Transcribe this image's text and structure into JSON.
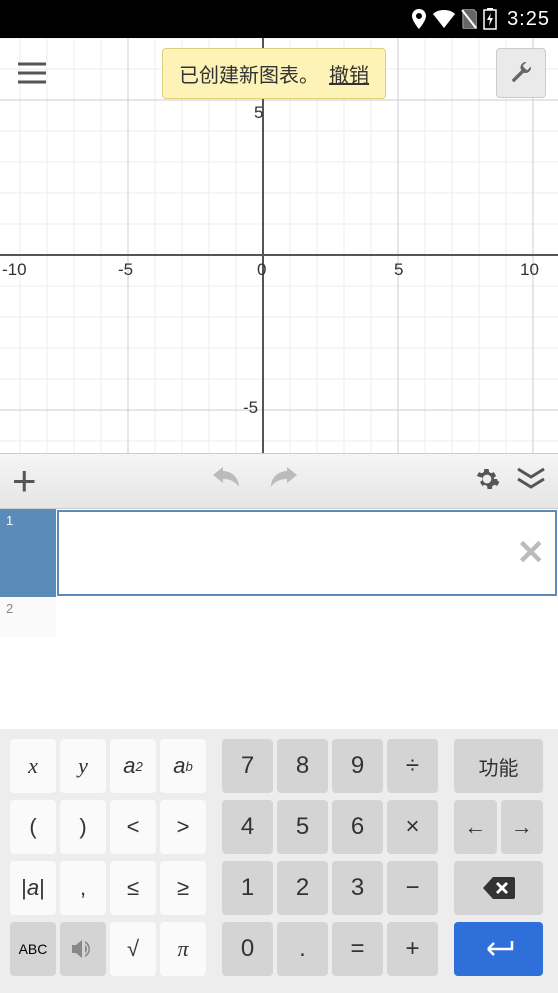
{
  "status": {
    "time": "3:25"
  },
  "toast": {
    "message": "已创建新图表。",
    "undo": "撤销"
  },
  "chart_data": {
    "type": "line",
    "series": [],
    "title": "",
    "xlabel": "",
    "ylabel": "",
    "xlim": [
      -10,
      10
    ],
    "ylim": [
      -5,
      5
    ],
    "xticks": [
      -10,
      -5,
      0,
      5,
      10
    ],
    "yticks": [
      -5,
      5
    ],
    "grid": true
  },
  "expressions": {
    "rows": [
      {
        "index": "1",
        "value": "",
        "active": true
      },
      {
        "index": "2",
        "value": "",
        "active": false
      }
    ]
  },
  "keyboard": {
    "r1": {
      "c1": "x",
      "c2": "y",
      "c3_base": "a",
      "c3_sup": "2",
      "c4_base": "a",
      "c4_sup": "b",
      "c5": "7",
      "c6": "8",
      "c7": "9",
      "c8": "÷",
      "c9": "功能"
    },
    "r2": {
      "c1": "(",
      "c2": ")",
      "c3": "<",
      "c4": ">",
      "c5": "4",
      "c6": "5",
      "c7": "6",
      "c8": "×"
    },
    "r3": {
      "c1_l": "|",
      "c1_m": "a",
      "c1_r": "|",
      "c2": ",",
      "c3": "≤",
      "c4": "≥",
      "c5": "1",
      "c6": "2",
      "c7": "3",
      "c8": "−"
    },
    "r4": {
      "c1": "ABC",
      "c3": "√",
      "c4": "π",
      "c5": "0",
      "c6": ".",
      "c7": "=",
      "c8": "+"
    }
  }
}
